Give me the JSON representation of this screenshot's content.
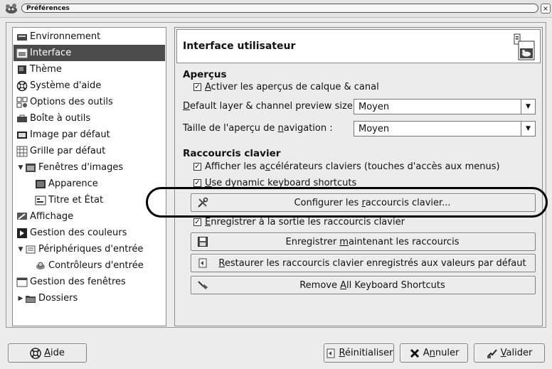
{
  "window": {
    "title": "Préférences",
    "close_glyph": "×"
  },
  "tree": {
    "items": [
      {
        "label": "Environnement",
        "icon": "environment-icon",
        "expander": "",
        "selected": false,
        "indent": 0
      },
      {
        "label": "Interface",
        "icon": "interface-icon",
        "expander": "",
        "selected": true,
        "indent": 0
      },
      {
        "label": "Thème",
        "icon": "theme-icon",
        "expander": "",
        "selected": false,
        "indent": 0
      },
      {
        "label": "Système d'aide",
        "icon": "help-system-icon",
        "expander": "",
        "selected": false,
        "indent": 0
      },
      {
        "label": "Options des outils",
        "icon": "tool-options-icon",
        "expander": "",
        "selected": false,
        "indent": 0
      },
      {
        "label": "Boîte à outils",
        "icon": "toolbox-icon",
        "expander": "",
        "selected": false,
        "indent": 0
      },
      {
        "label": "Image par défaut",
        "icon": "default-image-icon",
        "expander": "",
        "selected": false,
        "indent": 0
      },
      {
        "label": "Grille par défaut",
        "icon": "default-grid-icon",
        "expander": "",
        "selected": false,
        "indent": 0
      },
      {
        "label": "Fenêtres d'images",
        "icon": "image-windows-icon",
        "expander": "▼",
        "selected": false,
        "indent": 0
      },
      {
        "label": "Apparence",
        "icon": "appearance-icon",
        "expander": "",
        "selected": false,
        "indent": 1
      },
      {
        "label": "Titre et État",
        "icon": "title-status-icon",
        "expander": "",
        "selected": false,
        "indent": 1
      },
      {
        "label": "Affichage",
        "icon": "display-icon",
        "expander": "",
        "selected": false,
        "indent": 0
      },
      {
        "label": "Gestion des couleurs",
        "icon": "color-management-icon",
        "expander": "",
        "selected": false,
        "indent": 0
      },
      {
        "label": "Périphériques d'entrée",
        "icon": "input-devices-icon",
        "expander": "▼",
        "selected": false,
        "indent": 0
      },
      {
        "label": "Contrôleurs d'entrée",
        "icon": "input-controllers-icon",
        "expander": "",
        "selected": false,
        "indent": 1
      },
      {
        "label": "Gestion des fenêtres",
        "icon": "window-management-icon",
        "expander": "",
        "selected": false,
        "indent": 0
      },
      {
        "label": "Dossiers",
        "icon": "folders-icon",
        "expander": "▶",
        "selected": false,
        "indent": 0
      }
    ]
  },
  "page": {
    "title": "Interface utilisateur",
    "previews": {
      "section_title": "Aperçus",
      "enable_previews": {
        "before": "",
        "key": "A",
        "after": "ctiver les aperçus de calque & canal",
        "checked": true
      },
      "layer_preview_size": {
        "label_before": "",
        "key": "D",
        "label_after": "efault layer & channel preview size:",
        "value": "Moyen"
      },
      "nav_preview_size": {
        "label_before": "Taille de l'aperçu de ",
        "key": "n",
        "label_after": "avigation :",
        "value": "Moyen"
      }
    },
    "shortcuts": {
      "section_title": "Raccourcis clavier",
      "show_accels": {
        "before": "Afficher les a",
        "key": "c",
        "after": "célérateurs claviers (touches d'accès aux menus)",
        "checked": true
      },
      "dynamic": {
        "before": "",
        "key": "U",
        "after": "se dynamic keyboard shortcuts",
        "checked": true
      },
      "configure_button": {
        "before": "Configurer les ",
        "key": "r",
        "after": "accourcis clavier...",
        "icon": "tools-icon"
      },
      "save_on_exit": {
        "before": "",
        "key": "E",
        "after": "nregistrer à la sortie les raccourcis clavier",
        "checked": true
      },
      "save_now_button": {
        "before": "Enregistrer ",
        "key": "m",
        "after": "aintenant les raccourcis",
        "icon": "save-icon"
      },
      "restore_button": {
        "before": "",
        "key": "R",
        "after": "estaurer les raccourcis clavier enregistrés aux valeurs par défaut",
        "icon": "restore-icon"
      },
      "remove_all_button": {
        "before": "Remove ",
        "key": "A",
        "after": "ll Keyboard Shortcuts",
        "icon": "clear-icon"
      }
    }
  },
  "buttons": {
    "help": {
      "before": "",
      "key": "A",
      "after": "ide",
      "icon": "help-icon"
    },
    "reset": {
      "before": "",
      "key": "R",
      "after": "éinitialiser",
      "icon": "reset-icon"
    },
    "cancel": {
      "before": "A",
      "key": "n",
      "after": "nuler",
      "icon": "cancel-icon"
    },
    "ok": {
      "before": "",
      "key": "V",
      "after": "alider",
      "icon": "ok-icon"
    }
  },
  "colors": {
    "selection": "#4b4b4b",
    "highlight_ring": "#000000"
  }
}
